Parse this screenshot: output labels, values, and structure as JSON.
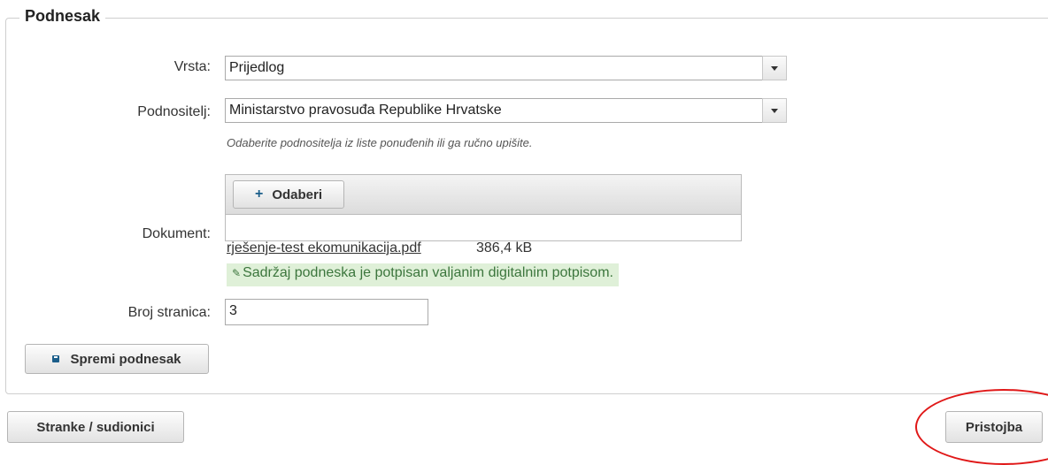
{
  "panel": {
    "legend": "Podnesak"
  },
  "form": {
    "vrsta": {
      "label": "Vrsta:",
      "value": "Prijedlog"
    },
    "podnositelj": {
      "label": "Podnositelj:",
      "value": "Ministarstvo pravosuđa Republike Hrvatske",
      "hint": "Odaberite podnositelja iz liste ponuđenih ili ga ručno upišite."
    },
    "dokument": {
      "label": "Dokument:",
      "choose_button": "Odaberi",
      "file_name": "rješenje-test ekomunikacija.pdf",
      "file_size": "386,4 kB",
      "signature_status": "Sadržaj podneska je potpisan valjanim digitalnim potpisom."
    },
    "broj_stranica": {
      "label": "Broj stranica:",
      "value": "3"
    },
    "save_button": "Spremi podnesak"
  },
  "footer": {
    "left_button": "Stranke / sudionici",
    "right_button": "Pristojba"
  },
  "colors": {
    "accent": "#1b5e8a",
    "success_bg": "#dff0d8",
    "success_text": "#3c763d",
    "annotation": "#e01818"
  },
  "icons": {
    "dropdown": "chevron-down-icon",
    "add": "plus-icon",
    "signature": "pencil-icon",
    "save": "save-icon"
  }
}
